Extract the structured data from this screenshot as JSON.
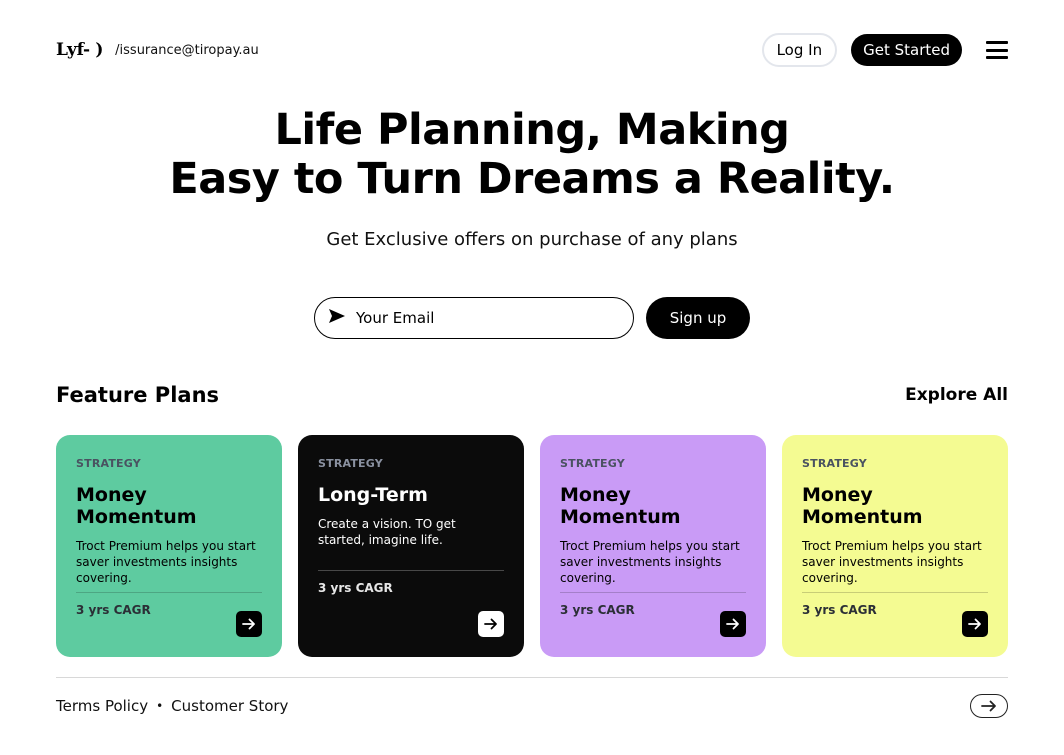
{
  "header": {
    "logo": "Lyf- )",
    "email": "/issurance@tiropay.au",
    "login_label": "Log In",
    "get_started_label": "Get Started",
    "menu_icon": "hamburger-menu-icon"
  },
  "hero": {
    "title_line1": "Life Planning, Making",
    "title_line2": "Easy to Turn Dreams a Reality.",
    "subtitle": "Get Exclusive offers on purchase of any plans"
  },
  "signup": {
    "email_placeholder": "Your Email",
    "send_icon": "send-icon",
    "button_label": "Sign up"
  },
  "features": {
    "title": "Feature Plans",
    "explore_label": "Explore All",
    "cards": [
      {
        "kicker": "STRATEGY",
        "title": "Money Momentum",
        "desc": "Troct Premium helps you start saver investments insights covering.",
        "cagr": "3 yrs CAGR",
        "color": "#5ecba0"
      },
      {
        "kicker": "STRATEGY",
        "title": "Long-Term",
        "desc": "Create a vision. TO get started, imagine life.",
        "cagr": "3 yrs CAGR",
        "color": "#0b0b0b"
      },
      {
        "kicker": "STRATEGY",
        "title": "Money Momentum",
        "desc": "Troct Premium helps you start saver investments insights covering.",
        "cagr": "3 yrs CAGR",
        "color": "#c99bf6"
      },
      {
        "kicker": "STRATEGY",
        "title": "Money Momentum",
        "desc": "Troct Premium helps you start saver investments insights covering.",
        "cagr": "3 yrs CAGR",
        "color": "#f4fb92"
      }
    ]
  },
  "footer": {
    "links": [
      "Terms Policy",
      "Customer Story"
    ],
    "separator": "•",
    "arrow_icon": "arrow-right-icon"
  }
}
